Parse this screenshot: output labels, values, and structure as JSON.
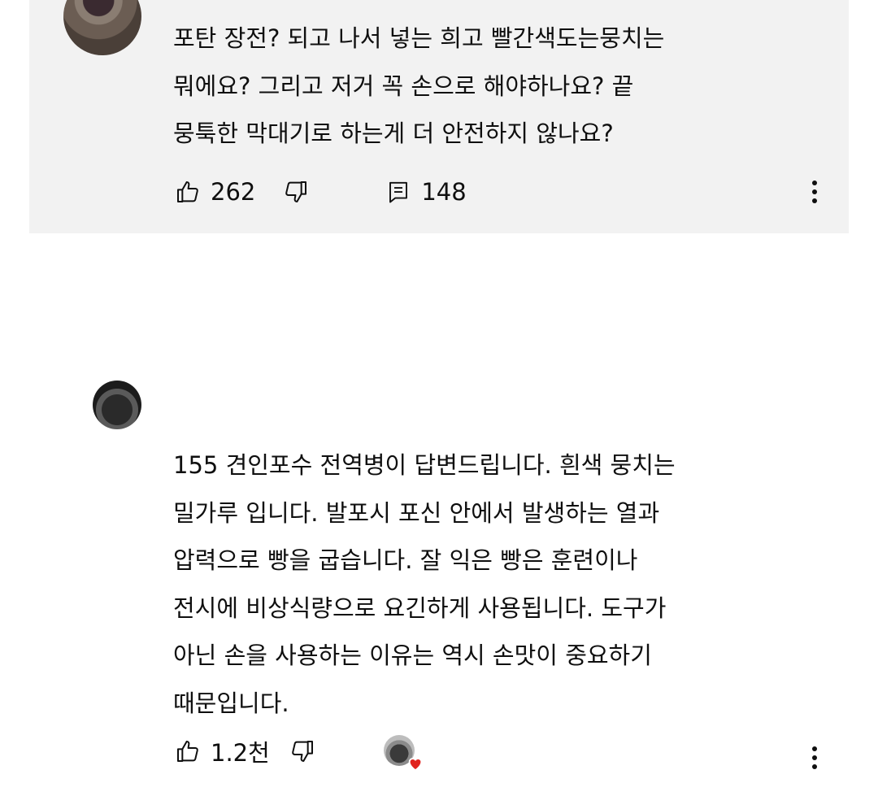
{
  "comments": [
    {
      "lines": [
        "포탄 장전? 되고 나서 넣는 희고 빨간색도는뭉치는",
        "뭐에요? 그리고 저거 꼭 손으로 해야하나요? 끝",
        "뭉툭한 막대기로 하는게 더 안전하지 않나요?"
      ],
      "likes": "262",
      "replies": "148"
    },
    {
      "lines": [
        "155 견인포수 전역병이 답변드립니다. 흰색 뭉치는",
        "밀가루 입니다. 발포시 포신 안에서 발생하는 열과",
        "압력으로 빵을 굽습니다. 잘 익은 빵은 훈련이나",
        "전시에 비상식량으로 요긴하게 사용됩니다. 도구가",
        "아닌 손을 사용하는 이유는 역시 손맛이 중요하기",
        "때문입니다."
      ],
      "likes": "1.2천",
      "creator_hearted": true
    }
  ],
  "icons": {
    "like": "thumbs-up-icon",
    "dislike": "thumbs-down-icon",
    "reply": "comment-icon",
    "more": "more-vert-icon",
    "heart": "heart-icon"
  },
  "colors": {
    "highlight_bg": "#f2f2f2",
    "text": "#0f0f0f",
    "heart": "#e0241f"
  }
}
